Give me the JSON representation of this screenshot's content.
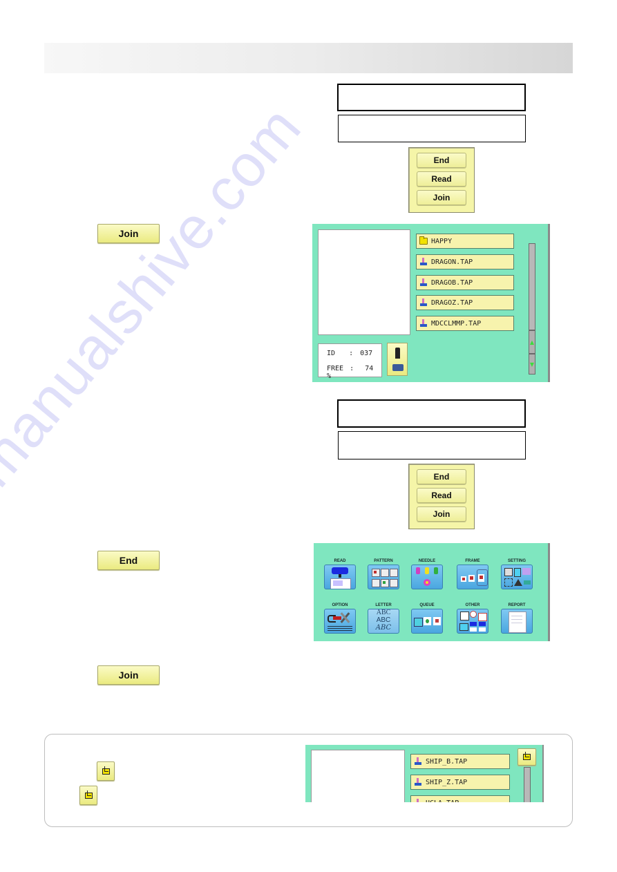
{
  "page": {
    "header_bar": "",
    "watermark": "manualshive.com"
  },
  "step1": {
    "message_boxes": [
      "",
      ""
    ],
    "popup_menu": {
      "items": [
        "End",
        "Read",
        "Join"
      ]
    },
    "join_button": "Join"
  },
  "file_screen": {
    "files": [
      {
        "name": "HAPPY",
        "type": "folder"
      },
      {
        "name": "DRAGON.TAP",
        "type": "tap"
      },
      {
        "name": "DRAGOB.TAP",
        "type": "tap"
      },
      {
        "name": "DRAGOZ.TAP",
        "type": "tap"
      },
      {
        "name": "MDCCLMMP.TAP",
        "type": "tap"
      }
    ],
    "info": {
      "id_label": "ID",
      "id_sep": ":",
      "id_value": "037",
      "free_label": "FREE",
      "free_sep": ":",
      "free_value": "74 %"
    },
    "scroll": {
      "up": "▲",
      "down": "▼"
    }
  },
  "step2": {
    "message_boxes": [
      "",
      ""
    ],
    "popup_menu": {
      "items": [
        "End",
        "Read",
        "Join"
      ]
    },
    "end_button": "End",
    "join_button": "Join"
  },
  "main_menu": {
    "items": [
      {
        "label": "READ",
        "icon": "read-icon"
      },
      {
        "label": "PATTERN",
        "icon": "pattern-icon"
      },
      {
        "label": "NEEDLE",
        "icon": "needle-icon"
      },
      {
        "label": "FRAME",
        "icon": "frame-icon"
      },
      {
        "label": "SETTING",
        "icon": "setting-icon"
      },
      {
        "label": "OPTION",
        "icon": "option-icon"
      },
      {
        "label": "LETTER",
        "icon": "letter-icon"
      },
      {
        "label": "QUEUE",
        "icon": "queue-icon"
      },
      {
        "label": "OTHER",
        "icon": "other-icon"
      },
      {
        "label": "REPORT",
        "icon": "report-icon"
      }
    ],
    "letter_icon_text": [
      "ABC",
      "ABC",
      "ABC"
    ]
  },
  "note": {
    "files": [
      {
        "name": "SHIP_B.TAP",
        "type": "tap"
      },
      {
        "name": "SHIP_Z.TAP",
        "type": "tap"
      },
      {
        "name": "UCLA.TAP",
        "type": "tap"
      }
    ]
  }
}
